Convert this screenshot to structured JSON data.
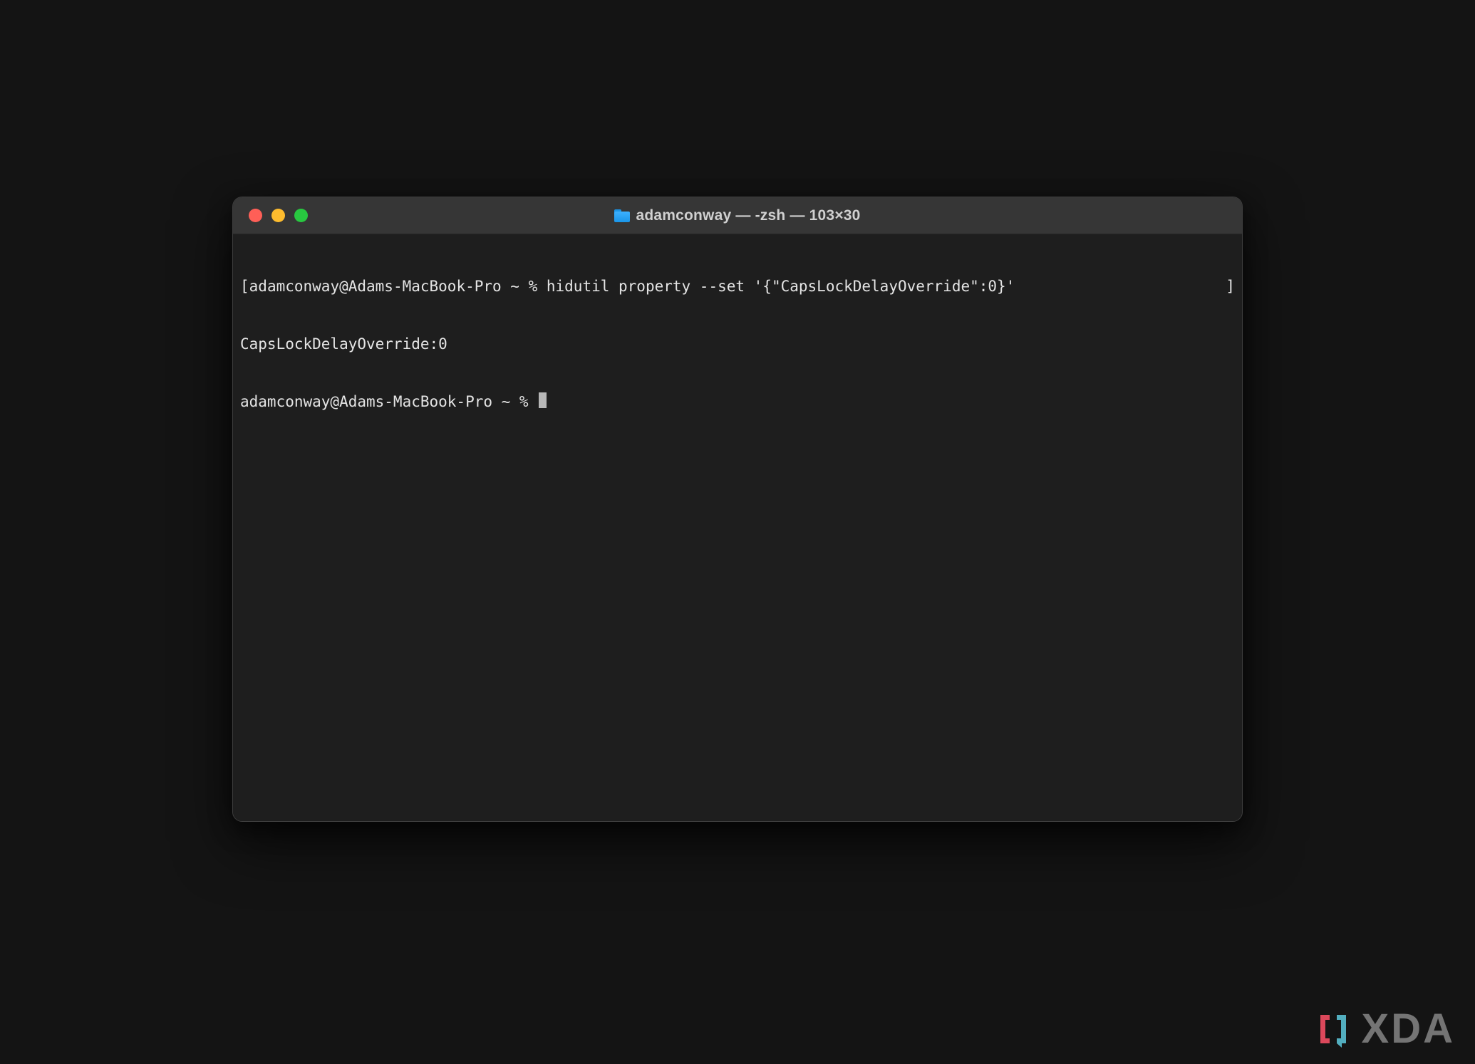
{
  "window": {
    "title": "adamconway — -zsh — 103×30"
  },
  "terminal": {
    "lines": [
      {
        "open": "[",
        "text": "adamconway@Adams-MacBook-Pro ~ % hidutil property --set '{\"CapsLockDelayOverride\":0}'",
        "close": "]"
      },
      {
        "open": "",
        "text": "CapsLockDelayOverride:0",
        "close": ""
      },
      {
        "open": "",
        "text": "adamconway@Adams-MacBook-Pro ~ % ",
        "close": ""
      }
    ]
  },
  "watermark": {
    "text": "XDA"
  }
}
